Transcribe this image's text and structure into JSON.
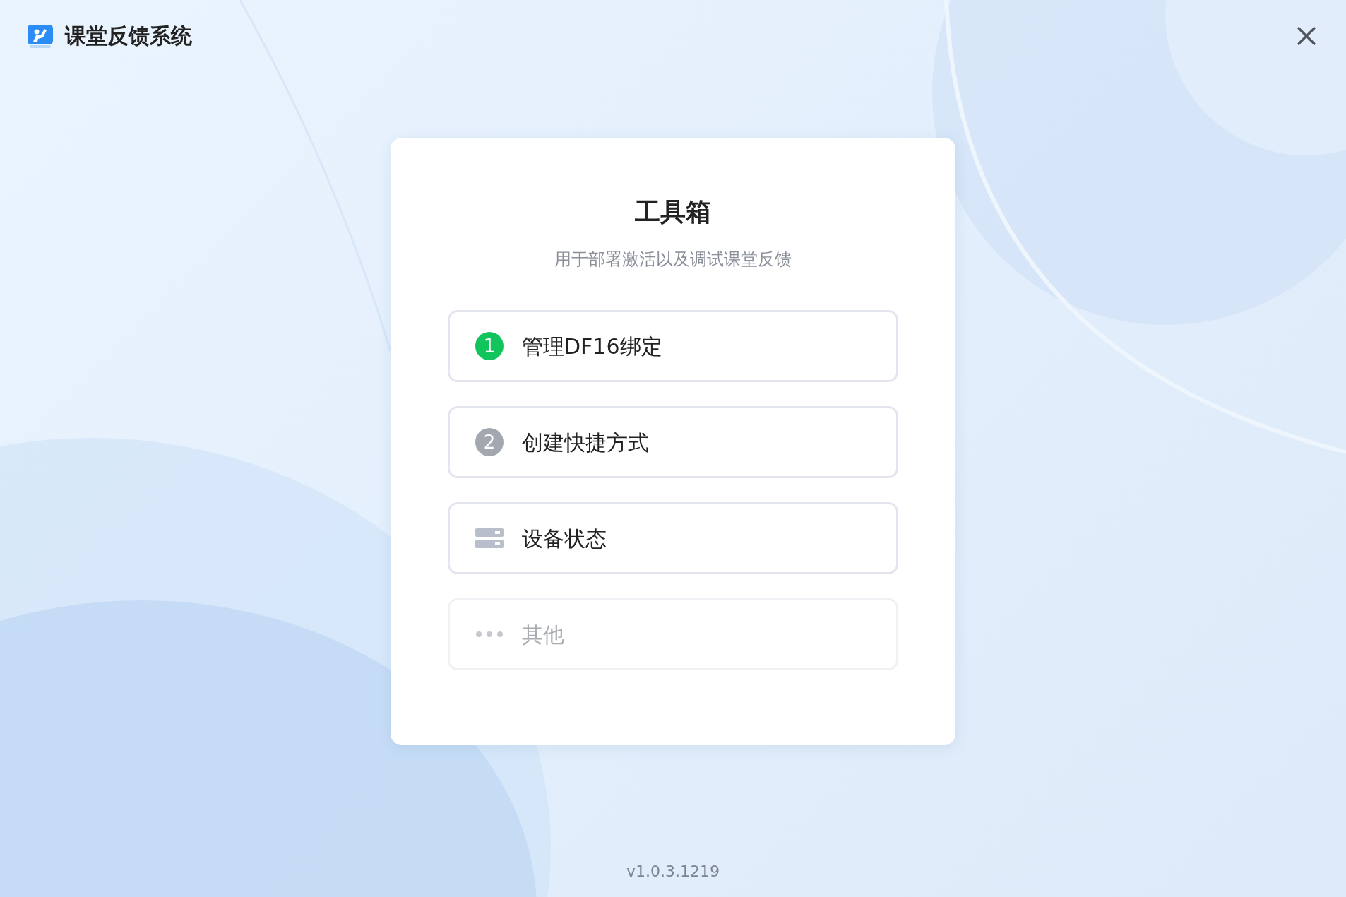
{
  "window": {
    "title": "课堂反馈系统"
  },
  "card": {
    "title": "工具箱",
    "subtitle": "用于部署激活以及调试课堂反馈"
  },
  "items": [
    {
      "kind": "step",
      "number": "1",
      "done": true,
      "label": "管理DF16绑定",
      "disabled": false
    },
    {
      "kind": "step",
      "number": "2",
      "done": false,
      "label": "创建快捷方式",
      "disabled": false
    },
    {
      "kind": "device",
      "label": "设备状态",
      "disabled": false
    },
    {
      "kind": "more",
      "label": "其他",
      "disabled": true
    }
  ],
  "version": "v1.0.3.1219"
}
